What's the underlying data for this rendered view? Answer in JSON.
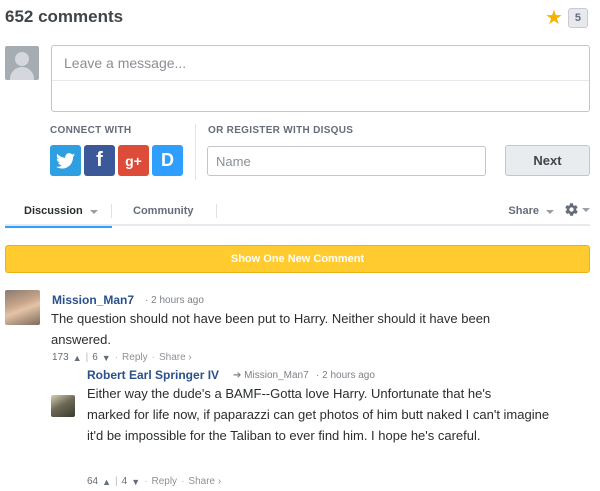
{
  "header": {
    "comment_count": "652 comments",
    "recommend_count": "5"
  },
  "composer": {
    "placeholder": "Leave a message..."
  },
  "connect": {
    "label": "CONNECT WITH",
    "services": [
      "t",
      "f",
      "g+",
      "D"
    ]
  },
  "register": {
    "label": "OR REGISTER WITH DISQUS",
    "name_placeholder": "Name",
    "next_label": "Next"
  },
  "nav": {
    "tabs": [
      "Discussion",
      "Community"
    ],
    "share_label": "Share"
  },
  "new_comment_button": "Show One New Comment",
  "comments": [
    {
      "author": "Mission_Man7",
      "time": "2 hours ago",
      "text": [
        "The question should not have been put to Harry. Neither should it have been",
        "answered."
      ],
      "upvotes": "173",
      "downvotes": "6",
      "reply": "Reply",
      "share": "Share ›"
    },
    {
      "author": "Robert Earl Springer IV",
      "reply_to": "Mission_Man7",
      "time": "2 hours ago",
      "text": [
        "Either way the dude's a BAMF--Gotta love Harry. Unfortunate that he's",
        "marked for life now, if paparazzi can get photos of him butt naked I can't imagine",
        "it'd be impossible for the Taliban to ever find him. I hope he's careful."
      ],
      "upvotes": "64",
      "downvotes": "4",
      "reply": "Reply",
      "share": "Share ›"
    }
  ],
  "colors": {
    "accent": "#2e9fff",
    "author": "#2a5189",
    "banner": "#ffcb2f",
    "star": "#f5b300"
  },
  "icons": [
    "star-icon",
    "user-placeholder-icon",
    "twitter-icon",
    "facebook-icon",
    "google-plus-icon",
    "disqus-icon",
    "gear-icon",
    "upvote-icon",
    "downvote-icon",
    "reply-arrow-icon"
  ]
}
